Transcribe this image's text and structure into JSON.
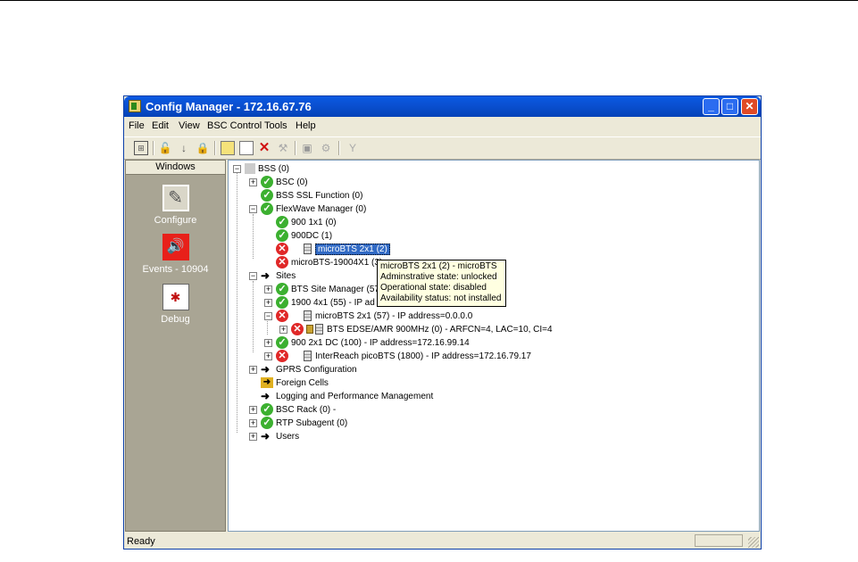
{
  "window": {
    "title": "Config Manager - 172.16.67.76"
  },
  "menu": [
    "File",
    "Edit",
    "View",
    "BSC Control",
    "Tools",
    "Help"
  ],
  "toolbar_icons": [
    "tree-view-icon",
    "unlock-icon",
    "down-arrow-icon",
    "lock-icon",
    "properties-icon",
    "paste-icon",
    "delete-icon",
    "tool-icon",
    "save-icon",
    "gear-icon",
    "antenna-icon"
  ],
  "left_panel": {
    "header": "Windows",
    "items": [
      {
        "label": "Configure",
        "icon": "wrench-icon"
      },
      {
        "label": "Events - 10904",
        "icon": "speaker-icon"
      },
      {
        "label": "Debug",
        "icon": "bug-icon"
      }
    ]
  },
  "tree": {
    "bss": "BSS (0)",
    "bsc": "BSC (0)",
    "bss_ssl": "BSS SSL Function (0)",
    "flexwave": "FlexWave Manager (0)",
    "fw_900_1x1": "900 1x1 (0)",
    "fw_900dc": "900DC (1)",
    "fw_microbts_2x1": "microBTS 2x1 (2)",
    "fw_microbts_19004x1": "microBTS-19004X1 (3)",
    "sites": "Sites",
    "bts_site_manager": "BTS Site Manager (57",
    "site_1900": "1900 4x1 (55) - IP ad",
    "site_microbts": "microBTS 2x1 (57) - IP address=0.0.0.0",
    "bts_edge": "BTS EDSE/AMR 900MHz (0) - ARFCN=4, LAC=10, CI=4",
    "site_900_2x1": "900 2x1 DC (100) - IP address=172.16.99.14",
    "interreach": "InterReach picoBTS (1800) - IP address=172.16.79.17",
    "gprs": "GPRS Configuration",
    "foreign_cells": "Foreign Cells",
    "logging": "Logging and Performance Management",
    "bsc_rack": "BSC Rack (0) -",
    "rtp": "RTP Subagent (0)",
    "users": "Users"
  },
  "tooltip": {
    "line1": "microBTS 2x1 (2) - microBTS",
    "line2": "Adminstrative state: unlocked",
    "line3": "Operational state: disabled",
    "line4": "Availability status: not installed"
  },
  "status": {
    "text": "Ready"
  }
}
